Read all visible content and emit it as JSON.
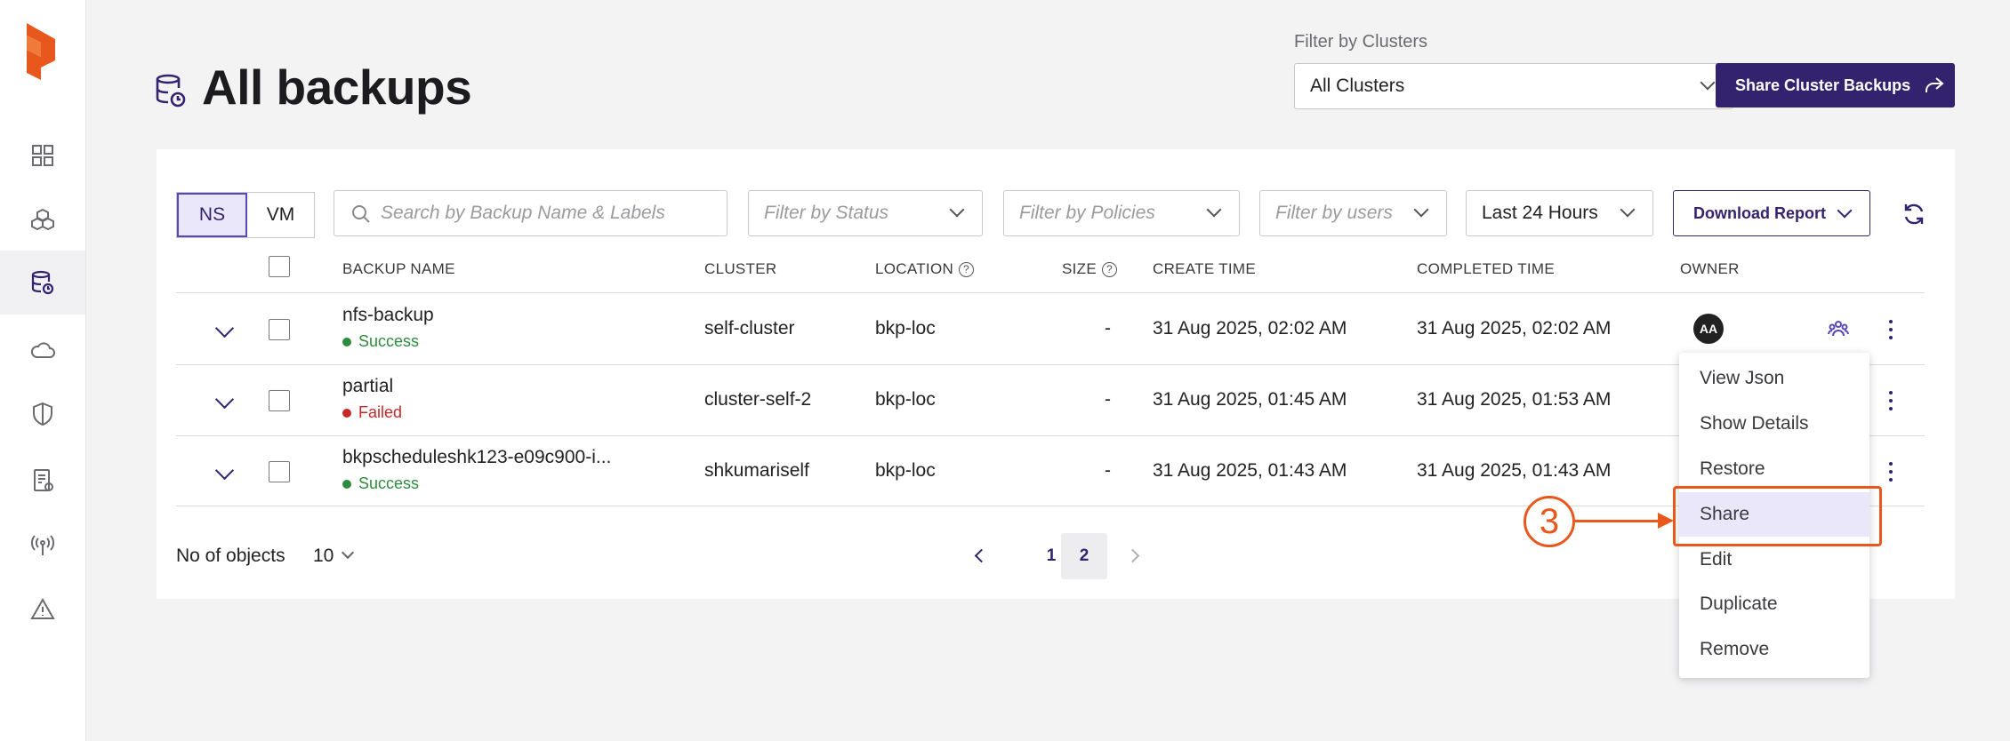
{
  "header": {
    "title": "All backups",
    "filter_label": "Filter by Clusters",
    "cluster_value": "All Clusters",
    "share_button": "Share Cluster Backups"
  },
  "toolbar": {
    "toggle": [
      "NS",
      "VM"
    ],
    "toggle_active": "NS",
    "search_placeholder": "Search by Backup Name & Labels",
    "status_placeholder": "Filter by Status",
    "policies_placeholder": "Filter by Policies",
    "users_placeholder": "Filter by users",
    "time_range": "Last 24 Hours",
    "download_button": "Download Report"
  },
  "table": {
    "columns": [
      "BACKUP NAME",
      "CLUSTER",
      "LOCATION",
      "SIZE",
      "CREATE TIME",
      "COMPLETED TIME",
      "OWNER"
    ],
    "rows": [
      {
        "name": "nfs-backup",
        "status": "Success",
        "cluster": "self-cluster",
        "location": "bkp-loc",
        "size": "-",
        "create_time": "31 Aug 2025, 02:02 AM",
        "completed_time": "31 Aug 2025, 02:02 AM",
        "owner": "AA"
      },
      {
        "name": "partial",
        "status": "Failed",
        "cluster": "cluster-self-2",
        "location": "bkp-loc",
        "size": "-",
        "create_time": "31 Aug 2025, 01:45 AM",
        "completed_time": "31 Aug 2025, 01:53 AM",
        "owner": ""
      },
      {
        "name": "bkpscheduleshk123-e09c900-i...",
        "status": "Success",
        "cluster": "shkumariself",
        "location": "bkp-loc",
        "size": "-",
        "create_time": "31 Aug 2025, 01:43 AM",
        "completed_time": "31 Aug 2025, 01:43 AM",
        "owner": ""
      }
    ]
  },
  "footer": {
    "objects_label": "No of objects",
    "per_page": "10",
    "pages": [
      "1",
      "2"
    ],
    "current_page": "2"
  },
  "menu": {
    "items": [
      "View Json",
      "Show Details",
      "Restore",
      "Share",
      "Edit",
      "Duplicate",
      "Remove"
    ],
    "highlighted": "Share"
  },
  "annotation": {
    "step_number": "3"
  },
  "colors": {
    "brand": "#33236e",
    "accent_orange": "#e8581c",
    "success": "#2e8b3e",
    "failed": "#c62828"
  },
  "icons": {
    "sidebar": [
      "dashboard-icon",
      "clusters-icon",
      "backups-icon",
      "cloud-icon",
      "shield-icon",
      "report-icon",
      "antenna-icon",
      "alert-icon"
    ]
  }
}
